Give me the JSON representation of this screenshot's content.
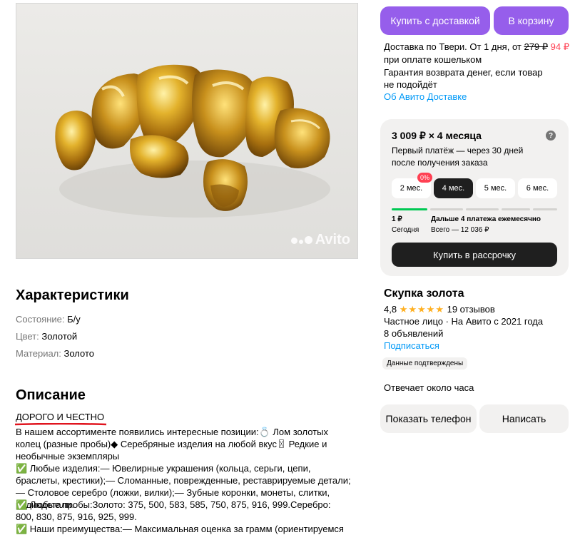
{
  "photo": {
    "watermark": "Avito"
  },
  "characteristics": {
    "title": "Характеристики",
    "rows": [
      {
        "key": "Состояние:",
        "value": "Б/у"
      },
      {
        "key": "Цвет:",
        "value": "Золотой"
      },
      {
        "key": "Материал:",
        "value": "Золото"
      }
    ]
  },
  "description": {
    "title": "Описание",
    "head": "ДОРОГО И ЧЕСТНО",
    "paragraphs": [
      "В нашем ассортименте появились интересные позиции:💍 Лом золотых колец (разные пробы)◆ Серебряные изделия на любой вкус〿 Редкие и необычные экземпляры",
      "✅ Любые изделия:— Ювелирные украшения (кольца, серьги, цепи, браслеты, крестики);— Сломанные, поврежденные, реставрируемые детали;— Столовое серебро (ложки, вилки);— Зубные коронки, монеты, слитки, радиодетали.",
      "✅ Любые пробы:Золото: 375, 500, 583, 585, 750, 875, 916, 999.Серебро: 800, 830, 875, 916, 925, 999.",
      "✅ Наши преимущества:— Максимальная оценка за грамм (ориентируемся на"
    ]
  },
  "actions": {
    "buy_delivery": "Купить с доставкой",
    "add_cart": "В корзину"
  },
  "delivery": {
    "line1_prefix": "Доставка по Твери. От 1 дня, от ",
    "old_price": "279 ₽",
    "new_price": "94 ₽",
    "line2": "при оплате кошельком",
    "line3": "Гарантия возврата денег, если товар",
    "line4": "не подойдёт",
    "link": "Об Авито Доставке"
  },
  "installment": {
    "title": "3 009 ₽ × 4 месяца",
    "help": "?",
    "subtitle": "Первый платёж — через 30 дней после получения заказа",
    "badge": "0%",
    "months": [
      "2 мес.",
      "4 мес.",
      "5 мес.",
      "6 мес."
    ],
    "selected_month_index": 1,
    "first_amount": "1 ₽",
    "first_when": "Сегодня",
    "rest_title": "Дальше 4 платежа ежемесячно",
    "rest_total": "Всего — 12 036 ₽",
    "buy_button": "Купить в рассрочку"
  },
  "seller": {
    "name": "Скупка золота",
    "rating": "4,8",
    "stars": "★★★★★",
    "reviews": "19 отзывов",
    "type_since": "Частное лицо · На Авито с 2021 года",
    "listings": "8 объявлений",
    "subscribe": "Подписаться",
    "verified": "Данные подтверждены",
    "response": "Отвечает около часа",
    "show_phone": "Показать телефон",
    "write": "Написать"
  },
  "colors": {
    "purple": "#965eeb",
    "link": "#0099f7",
    "red": "#ff4053",
    "star": "#ffb021",
    "progress_active": "#00c853"
  }
}
